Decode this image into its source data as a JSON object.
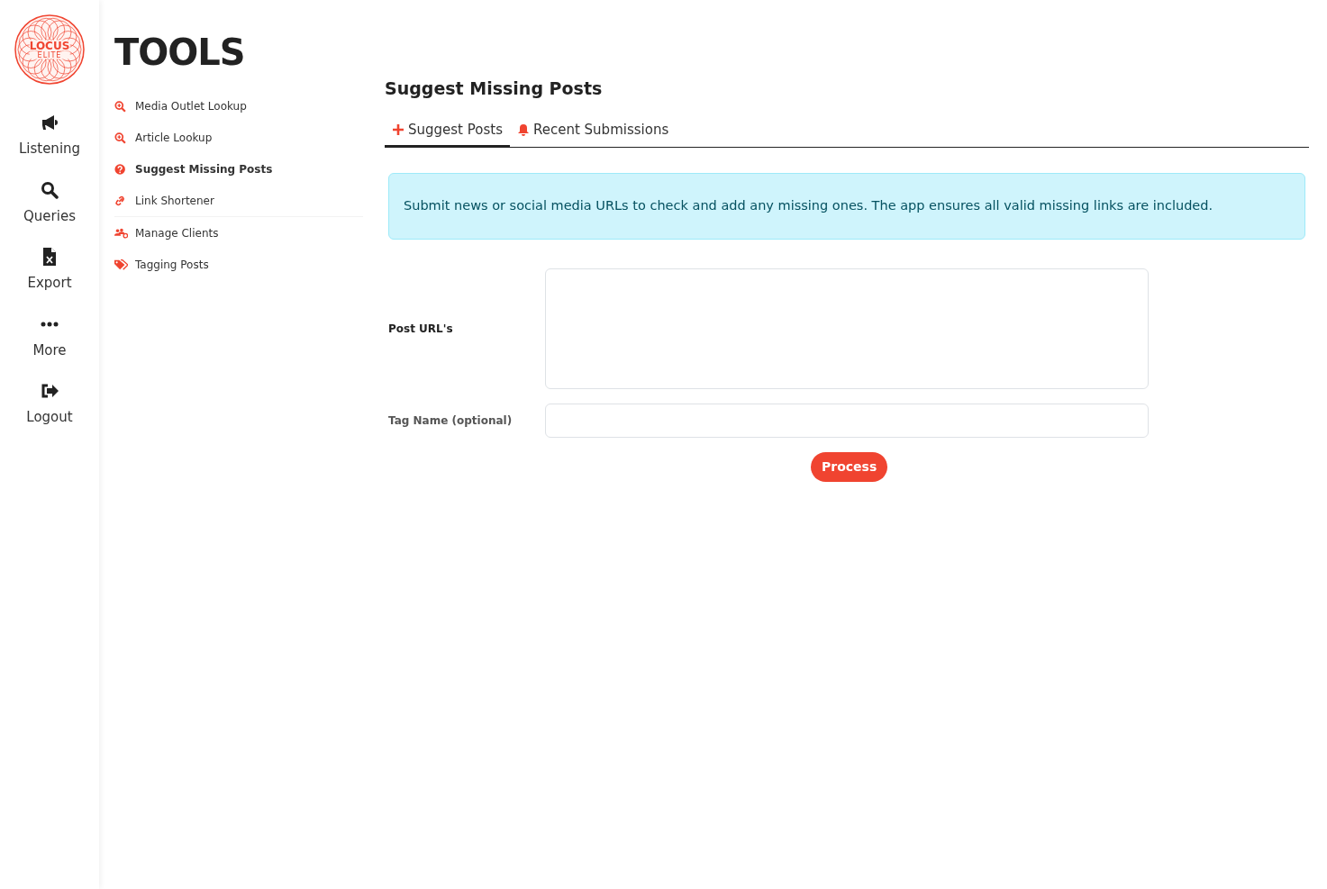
{
  "logo": {
    "title": "LOCUS",
    "subtitle": "ELITE"
  },
  "rail": [
    {
      "label": "Listening"
    },
    {
      "label": "Queries"
    },
    {
      "label": "Export"
    },
    {
      "label": "More"
    },
    {
      "label": "Logout"
    }
  ],
  "tools": {
    "title": "TOOLS",
    "groups": [
      [
        {
          "label": "Media Outlet Lookup",
          "selected": false
        },
        {
          "label": "Article Lookup",
          "selected": false
        },
        {
          "label": "Suggest Missing Posts",
          "selected": true
        },
        {
          "label": "Link Shortener",
          "selected": false
        }
      ],
      [
        {
          "label": "Manage Clients",
          "selected": false
        },
        {
          "label": "Tagging Posts",
          "selected": false
        }
      ]
    ]
  },
  "page": {
    "title": "Suggest Missing Posts",
    "tabs": [
      {
        "label": "Suggest Posts",
        "selected": true
      },
      {
        "label": "Recent Submissions",
        "selected": false
      }
    ],
    "info": "Submit news or social media URLs to check and add any missing ones. The app ensures all valid missing links are included.",
    "fields": [
      {
        "label": "Post URL's",
        "kind": "textarea"
      },
      {
        "label": "**Tag Name** (optional)",
        "kind": "input"
      }
    ],
    "button": "Process"
  }
}
